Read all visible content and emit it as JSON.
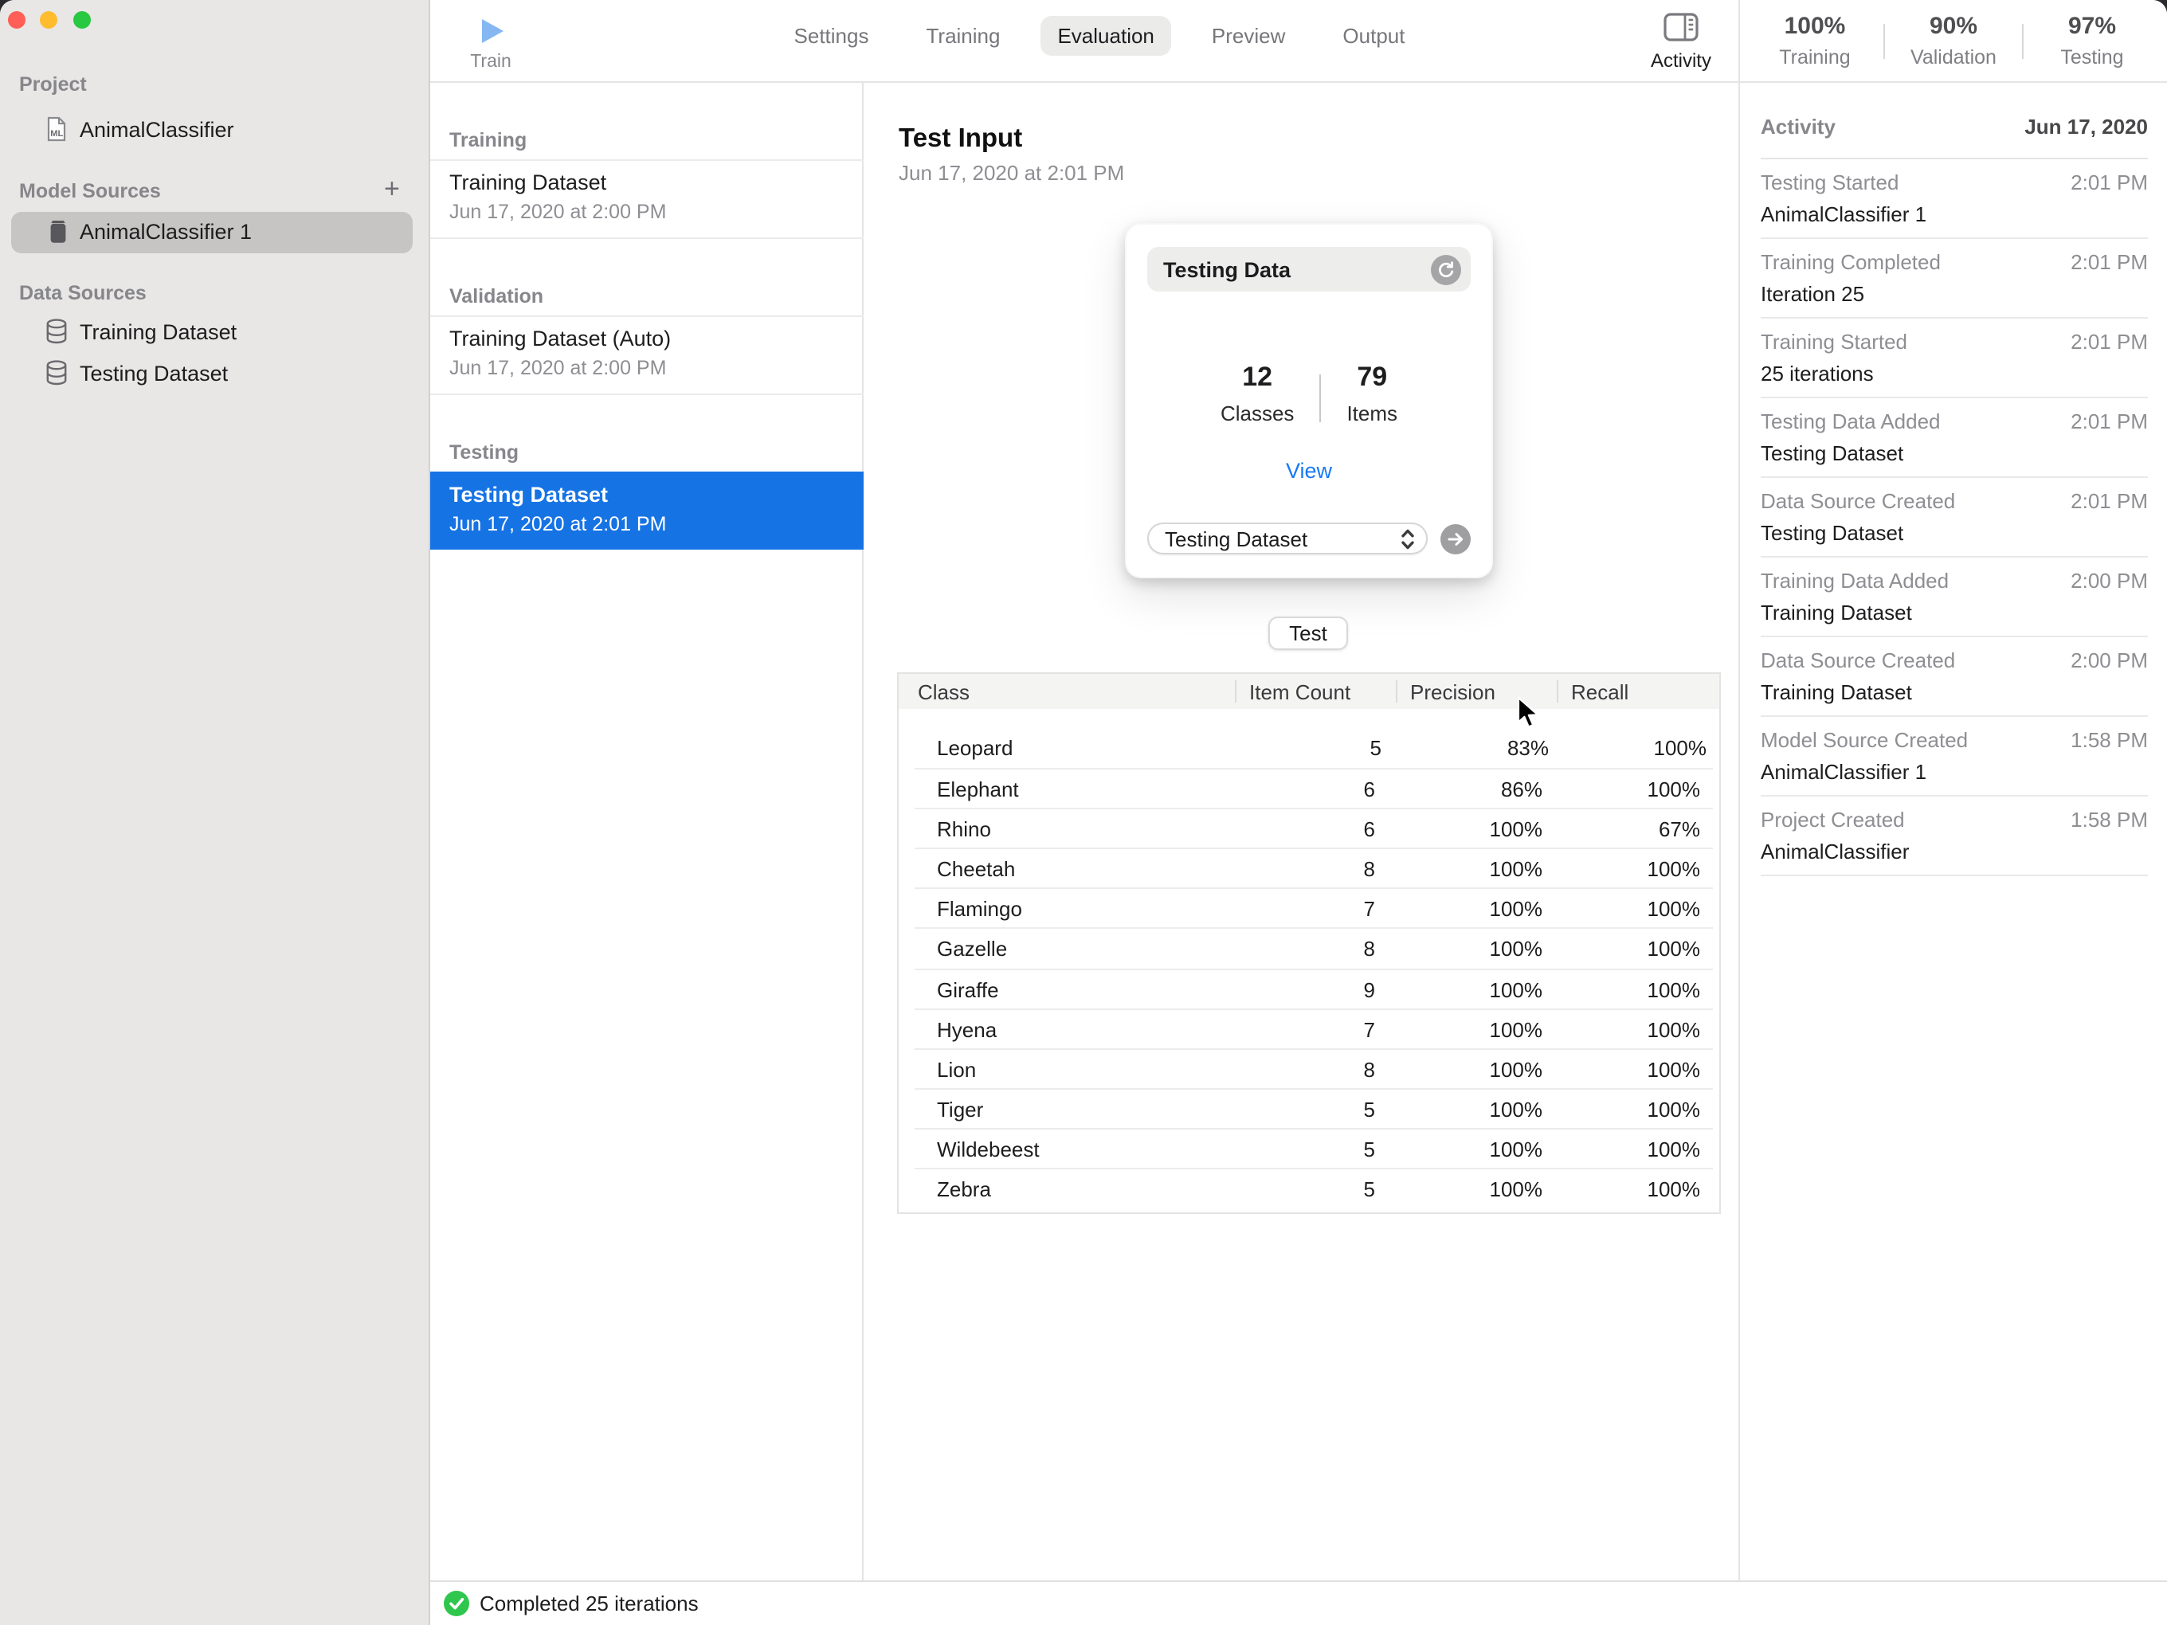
{
  "window": {
    "traffic_lights": [
      "close",
      "minimize",
      "zoom"
    ]
  },
  "sidebar": {
    "project_header": "Project",
    "project_item": "AnimalClassifier",
    "model_sources_header": "Model Sources",
    "add_button": "+",
    "model_source_item": "AnimalClassifier 1",
    "data_sources_header": "Data Sources",
    "data_source_items": [
      "Training Dataset",
      "Testing Dataset"
    ]
  },
  "toolbar": {
    "train_label": "Train",
    "tabs": [
      "Settings",
      "Training",
      "Evaluation",
      "Preview",
      "Output"
    ],
    "active_tab": "Evaluation",
    "activity_label": "Activity",
    "stats": [
      {
        "value": "100%",
        "label": "Training"
      },
      {
        "value": "90%",
        "label": "Validation"
      },
      {
        "value": "97%",
        "label": "Testing"
      }
    ]
  },
  "dataset_list": {
    "sections": [
      {
        "header": "Training",
        "title": "Training Dataset",
        "date": "Jun 17, 2020 at 2:00 PM",
        "selected": false
      },
      {
        "header": "Validation",
        "title": "Training Dataset (Auto)",
        "date": "Jun 17, 2020 at 2:00 PM",
        "selected": false
      },
      {
        "header": "Testing",
        "title": "Testing Dataset",
        "date": "Jun 17, 2020 at 2:01 PM",
        "selected": true
      }
    ]
  },
  "main": {
    "title": "Test Input",
    "date": "Jun 17, 2020 at 2:01 PM",
    "card": {
      "header": "Testing Data",
      "refresh_icon": "refresh-icon",
      "stats": [
        {
          "value": "12",
          "label": "Classes"
        },
        {
          "value": "79",
          "label": "Items"
        }
      ],
      "view_link": "View",
      "dropdown_value": "Testing Dataset",
      "go_icon": "arrow-right-icon"
    },
    "test_button": "Test",
    "table": {
      "columns": [
        "Class",
        "Item Count",
        "Precision",
        "Recall"
      ],
      "rows": [
        [
          "Leopard",
          "5",
          "83%",
          "100%"
        ],
        [
          "Elephant",
          "6",
          "86%",
          "100%"
        ],
        [
          "Rhino",
          "6",
          "100%",
          "67%"
        ],
        [
          "Cheetah",
          "8",
          "100%",
          "100%"
        ],
        [
          "Flamingo",
          "7",
          "100%",
          "100%"
        ],
        [
          "Gazelle",
          "8",
          "100%",
          "100%"
        ],
        [
          "Giraffe",
          "9",
          "100%",
          "100%"
        ],
        [
          "Hyena",
          "7",
          "100%",
          "100%"
        ],
        [
          "Lion",
          "8",
          "100%",
          "100%"
        ],
        [
          "Tiger",
          "5",
          "100%",
          "100%"
        ],
        [
          "Wildebeest",
          "5",
          "100%",
          "100%"
        ],
        [
          "Zebra",
          "5",
          "100%",
          "100%"
        ]
      ]
    }
  },
  "activity_panel": {
    "header": "Activity",
    "date": "Jun 17, 2020",
    "entries": [
      {
        "title": "Testing Started",
        "time": "2:01 PM",
        "subtitle": "AnimalClassifier 1"
      },
      {
        "title": "Training Completed",
        "time": "2:01 PM",
        "subtitle": "Iteration 25"
      },
      {
        "title": "Training Started",
        "time": "2:01 PM",
        "subtitle": "25 iterations"
      },
      {
        "title": "Testing Data Added",
        "time": "2:01 PM",
        "subtitle": "Testing Dataset"
      },
      {
        "title": "Data Source Created",
        "time": "2:01 PM",
        "subtitle": "Testing Dataset"
      },
      {
        "title": "Training Data Added",
        "time": "2:00 PM",
        "subtitle": "Training Dataset"
      },
      {
        "title": "Data Source Created",
        "time": "2:00 PM",
        "subtitle": "Training Dataset"
      },
      {
        "title": "Model Source Created",
        "time": "1:58 PM",
        "subtitle": "AnimalClassifier 1"
      },
      {
        "title": "Project Created",
        "time": "1:58 PM",
        "subtitle": "AnimalClassifier"
      }
    ]
  },
  "status_bar": {
    "message": "Completed 25 iterations"
  },
  "colors": {
    "selection_blue": "#1673e4",
    "link_blue": "#1779f6",
    "train_play_blue": "#85b7f3",
    "success_green": "#2fc64e",
    "traffic_red": "#ff5f57",
    "traffic_yellow": "#febc2e",
    "traffic_green": "#28c840",
    "sidebar_bg": "#e8e7e5",
    "selected_pill": "#c6c5c3"
  }
}
